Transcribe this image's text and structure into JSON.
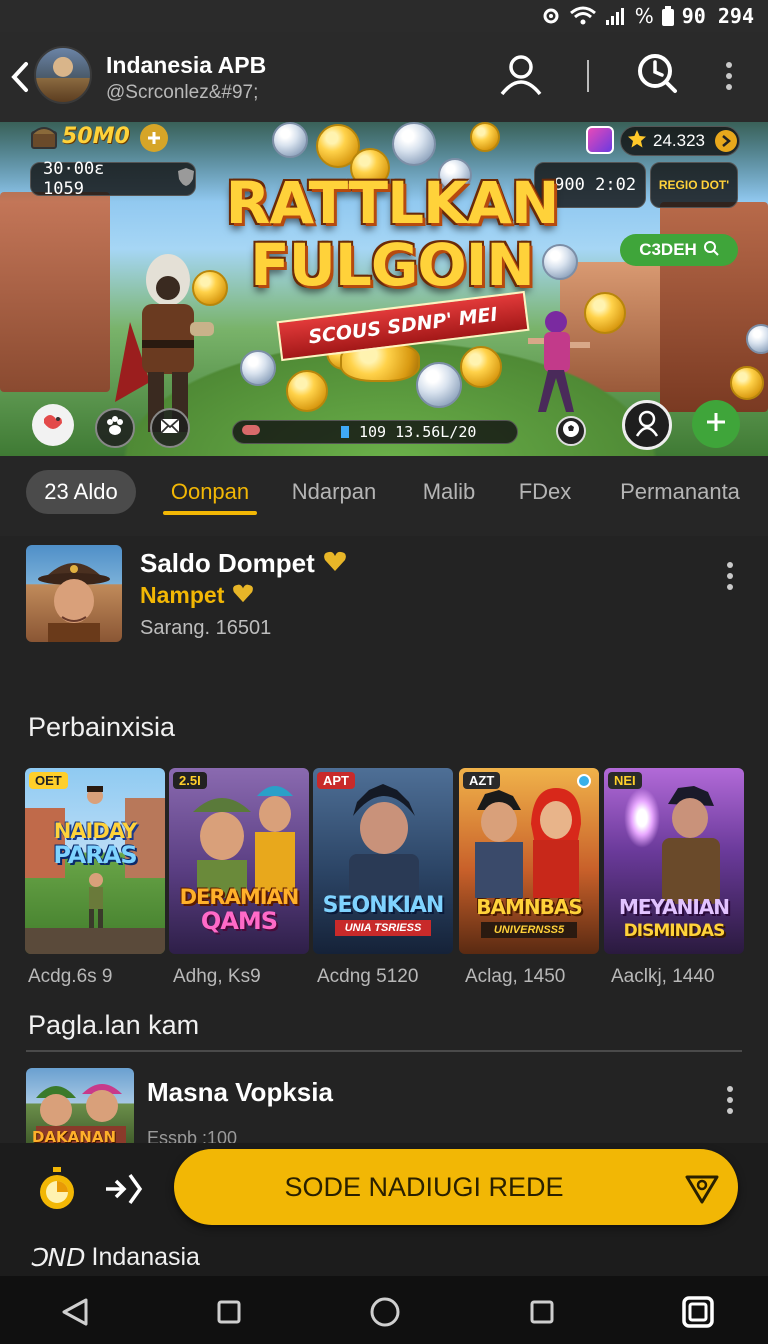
{
  "status_bar": {
    "time": "90 294",
    "battery_label": "%"
  },
  "header": {
    "title": "Indanesia APB",
    "subtitle": "@Scrconlez&#97;"
  },
  "banner": {
    "top_left_label": "50M0",
    "top_left_chip": "30·00ɛ 1059",
    "top_right_score": "24.323",
    "right_chip": ":900 2:02",
    "right_chip_badge": "REGIO DOT'",
    "title_line1": "RATTLKAN",
    "title_line2": "FULGOIN",
    "ribbon": "SCOUS SDNP' MEI",
    "green_pill": "C3DEH",
    "progress_text": "109 13.56L/20"
  },
  "tabs": [
    {
      "label": "23 Aldo"
    },
    {
      "label": "Oonpan"
    },
    {
      "label": "Ndarpan"
    },
    {
      "label": "Malib"
    },
    {
      "label": "FDex"
    },
    {
      "label": "Permananta"
    }
  ],
  "wallet": {
    "title": "Saldo Dompet",
    "subtitle": "Nampet",
    "meta": "Sarang. 16501"
  },
  "games_section": {
    "title": "Perbainxisia"
  },
  "games": [
    {
      "badge": "OET",
      "name": "NAIDAY PARAS",
      "meta": "Acdg.6s 9",
      "colors": {
        "bg1": "#7fc0ef",
        "bg2": "#5d9a3e",
        "text": "#ffd23a"
      }
    },
    {
      "badge": "2.5I",
      "name": "DERAMIAN QAMS",
      "meta": "Adhg, Ks9",
      "colors": {
        "bg1": "#6a4e8a",
        "bg2": "#3a2a55",
        "text": "#ffb02a"
      }
    },
    {
      "badge": "APT",
      "name": "SEONKIAN",
      "meta": "Acdng 5120",
      "colors": {
        "bg1": "#3b5f86",
        "bg2": "#1d2f48",
        "text": "#7fd3ff"
      }
    },
    {
      "badge": "AZT",
      "name": "BAMNBAS",
      "meta": "Aclag, 1450",
      "colors": {
        "bg1": "#e7a23a",
        "bg2": "#8a3a1a",
        "text": "#ffd23a"
      }
    },
    {
      "badge": "NEI",
      "name": "MEYANIAN DISMINDAS",
      "meta": "Aaclkj, 1440",
      "colors": {
        "bg1": "#8a4fb8",
        "bg2": "#3a1f55",
        "text": "#e2c3ff"
      }
    }
  ],
  "games_captions": {
    "card1": "NAIDAY",
    "card1b": "PARAS",
    "card2": "DERAMIAN",
    "card2b": "QAMS",
    "card3": "SEONKIAN",
    "card3b": "UNIA TSRIESS",
    "card4": "BAMNBAS",
    "card4b": "UNIVERNSS5",
    "card5": "MEYANIAN",
    "card5b": "DISMINDAS"
  },
  "list_section": {
    "title": "Pagla.lan kam"
  },
  "list_item": {
    "title": "Masna Vopksia",
    "meta": "Esspb :100",
    "thumb_caption": "DAKANAN"
  },
  "action": {
    "cta_label": "SODE NADIUGI REDE"
  },
  "brand": {
    "label": "Indanasia",
    "logo_text": "ƆND"
  }
}
